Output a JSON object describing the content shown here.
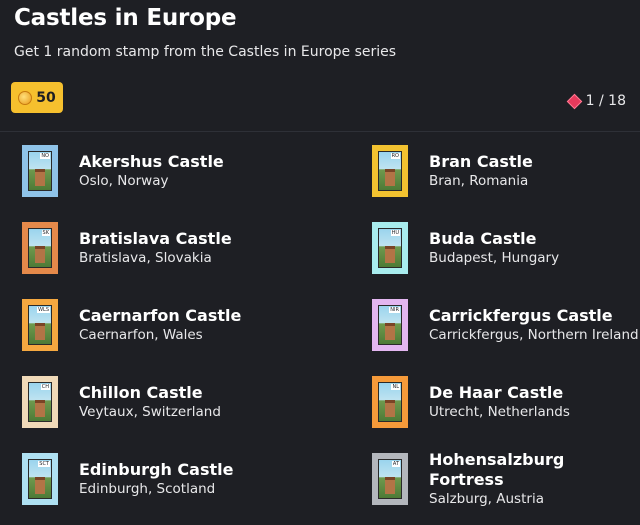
{
  "header": {
    "title": "Castles in Europe",
    "subtitle": "Get 1 random stamp from the Castles in Europe series",
    "price": "50",
    "price_icon": "coin-icon",
    "counter": "1 / 18",
    "counter_icon": "gem-icon"
  },
  "colors": {
    "background": "#1e1f24",
    "price_button": "#f6c02e"
  },
  "items": [
    {
      "name": "Akershus Castle",
      "location": "Oslo, Norway",
      "code": "NO",
      "frame": "#8fc3e8"
    },
    {
      "name": "Bran Castle",
      "location": "Bran, Romania",
      "code": "RO",
      "frame": "#f2c230"
    },
    {
      "name": "Bratislava Castle",
      "location": "Bratislava, Slovakia",
      "code": "SK",
      "frame": "#e5894a"
    },
    {
      "name": "Buda Castle",
      "location": "Budapest, Hungary",
      "code": "HU",
      "frame": "#a8ecee"
    },
    {
      "name": "Caernarfon Castle",
      "location": "Caernarfon, Wales",
      "code": "WLS",
      "frame": "#f5a840"
    },
    {
      "name": "Carrickfergus Castle",
      "location": "Carrickfergus, Northern Ireland",
      "code": "NIR",
      "frame": "#e3b6f0"
    },
    {
      "name": "Chillon Castle",
      "location": "Veytaux, Switzerland",
      "code": "CH",
      "frame": "#f0d9b8"
    },
    {
      "name": "De Haar Castle",
      "location": "Utrecht, Netherlands",
      "code": "NL",
      "frame": "#f59a3a"
    },
    {
      "name": "Edinburgh Castle",
      "location": "Edinburgh, Scotland",
      "code": "SCT",
      "frame": "#aee0f2"
    },
    {
      "name": "Hohensalzburg Fortress",
      "location": "Salzburg, Austria",
      "code": "AT",
      "frame": "#b3b6bc"
    }
  ]
}
